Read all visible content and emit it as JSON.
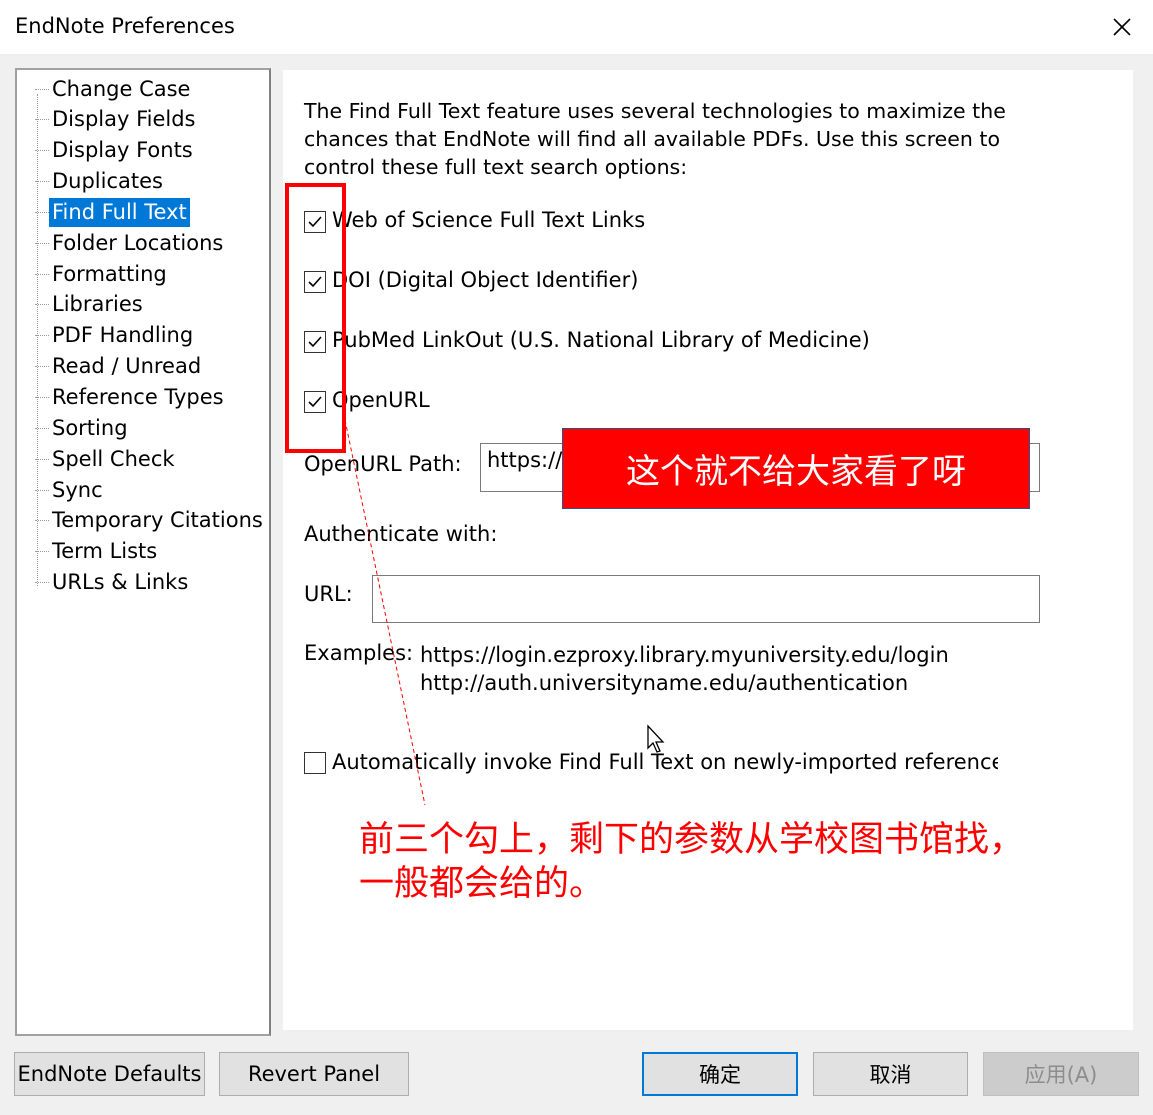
{
  "window": {
    "title": "EndNote Preferences"
  },
  "sidebar": {
    "items": [
      {
        "label": "Change Case"
      },
      {
        "label": "Display Fields"
      },
      {
        "label": "Display Fonts"
      },
      {
        "label": "Duplicates"
      },
      {
        "label": "Find Full Text",
        "selected": true
      },
      {
        "label": "Folder Locations"
      },
      {
        "label": "Formatting"
      },
      {
        "label": "Libraries"
      },
      {
        "label": "PDF Handling"
      },
      {
        "label": "Read / Unread"
      },
      {
        "label": "Reference Types"
      },
      {
        "label": "Sorting"
      },
      {
        "label": "Spell Check"
      },
      {
        "label": "Sync"
      },
      {
        "label": "Temporary Citations"
      },
      {
        "label": "Term Lists"
      },
      {
        "label": "URLs & Links"
      }
    ]
  },
  "panel": {
    "intro": "The Find Full Text feature uses several technologies to maximize the chances that EndNote will find all available PDFs. Use this screen to control these full text search options:",
    "options": [
      {
        "label": "Web of Science Full Text Links",
        "checked": true
      },
      {
        "label": "DOI (Digital Object Identifier)",
        "checked": true
      },
      {
        "label": "PubMed LinkOut (U.S. National Library of Medicine)",
        "checked": true
      },
      {
        "label": "OpenURL",
        "checked": true
      }
    ],
    "openurl_path_label": "OpenURL Path:",
    "openurl_path_value": "https://",
    "authenticate_label": "Authenticate with:",
    "url_label": "URL:",
    "url_value": "",
    "examples_label": "Examples:",
    "examples": [
      "https://login.ezproxy.library.myuniversity.edu/login",
      "http://auth.universityname.edu/authentication"
    ],
    "auto_invoke_label": "Automatically invoke Find Full Text on newly-imported references",
    "auto_invoke_checked": false
  },
  "buttons": {
    "endnote_defaults": "EndNote Defaults",
    "revert_panel": "Revert Panel",
    "ok": "确定",
    "cancel": "取消",
    "apply": "应用(A)"
  },
  "overlay": {
    "banner": "这个就不给大家看了呀",
    "annotation_line1": "前三个勾上，剩下的参数从学校图书馆找，",
    "annotation_line2": "一般都会给的。"
  },
  "colors": {
    "selection": "#0078d7",
    "annotation_red": "#ff0000",
    "banner_border": "#2f528f"
  }
}
